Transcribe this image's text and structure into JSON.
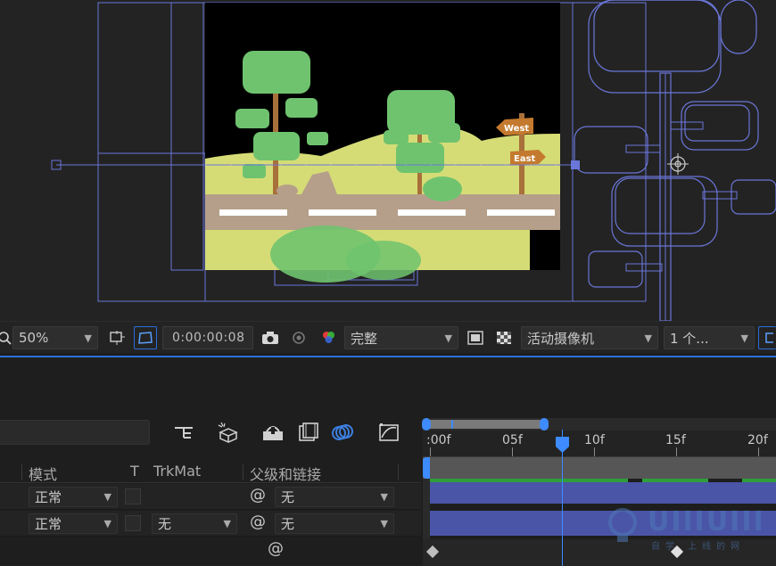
{
  "viewer": {
    "signs": {
      "west": "West",
      "east": "East"
    }
  },
  "toolbar": {
    "zoom": "50%",
    "timecode": "0:00:00:08",
    "resolution": "完整",
    "camera": "活动摄像机",
    "views": "1 个..."
  },
  "timeline": {
    "columns": {
      "mode": "模式",
      "t": "T",
      "trkmat": "TrkMat",
      "parent": "父级和链接"
    },
    "layers": [
      {
        "mode": "正常",
        "trkmat": "",
        "parent": "无"
      },
      {
        "mode": "正常",
        "trkmat": "无",
        "parent": "无"
      }
    ],
    "ruler": [
      ":00f",
      "05f",
      "10f",
      "15f",
      "20f"
    ],
    "playhead_frame": 8
  },
  "watermark": {
    "main": "UIIIUIII",
    "sub": "自学 上线的网"
  },
  "colors": {
    "accent": "#2d6fd8",
    "track": "#4a55a8",
    "sky": "#000000",
    "grass": "#d5dc76",
    "road": "#b59f8a",
    "tree": "#6fc36f"
  }
}
